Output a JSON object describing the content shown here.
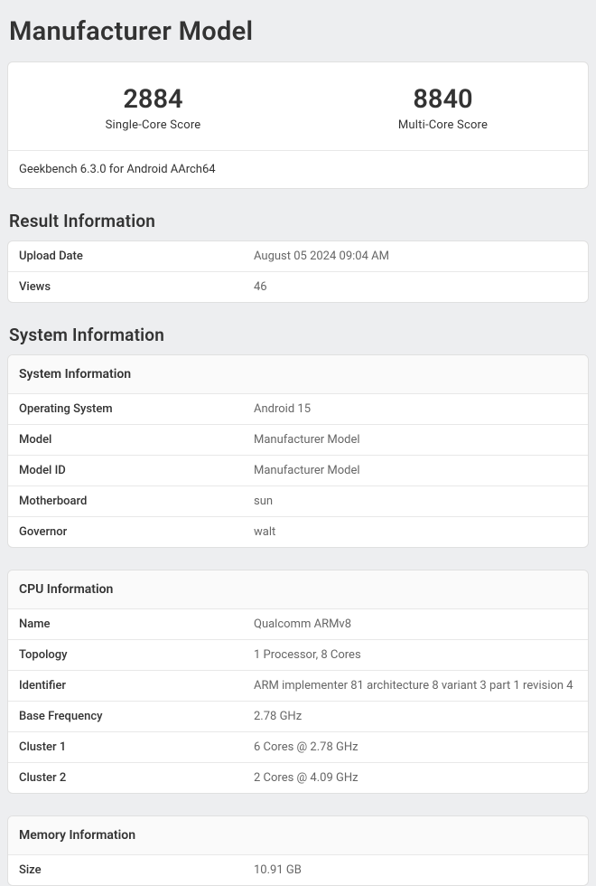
{
  "title": "Manufacturer Model",
  "scores": {
    "single_value": "2884",
    "single_label": "Single-Core Score",
    "multi_value": "8840",
    "multi_label": "Multi-Core Score"
  },
  "version": "Geekbench 6.3.0 for Android AArch64",
  "result_section": {
    "heading": "Result Information",
    "rows": [
      {
        "key": "Upload Date",
        "val": "August 05 2024 09:04 AM"
      },
      {
        "key": "Views",
        "val": "46"
      }
    ]
  },
  "system_section": {
    "heading": "System Information",
    "sys_info": {
      "header": "System Information",
      "rows": [
        {
          "key": "Operating System",
          "val": "Android 15"
        },
        {
          "key": "Model",
          "val": "Manufacturer Model"
        },
        {
          "key": "Model ID",
          "val": "Manufacturer Model"
        },
        {
          "key": "Motherboard",
          "val": "sun"
        },
        {
          "key": "Governor",
          "val": "walt"
        }
      ]
    },
    "cpu_info": {
      "header": "CPU Information",
      "rows": [
        {
          "key": "Name",
          "val": "Qualcomm ARMv8"
        },
        {
          "key": "Topology",
          "val": "1 Processor, 8 Cores"
        },
        {
          "key": "Identifier",
          "val": "ARM implementer 81 architecture 8 variant 3 part 1 revision 4"
        },
        {
          "key": "Base Frequency",
          "val": "2.78 GHz"
        },
        {
          "key": "Cluster 1",
          "val": "6 Cores @ 2.78 GHz"
        },
        {
          "key": "Cluster 2",
          "val": "2 Cores @ 4.09 GHz"
        }
      ]
    },
    "mem_info": {
      "header": "Memory Information",
      "rows": [
        {
          "key": "Size",
          "val": "10.91 GB"
        }
      ]
    }
  }
}
